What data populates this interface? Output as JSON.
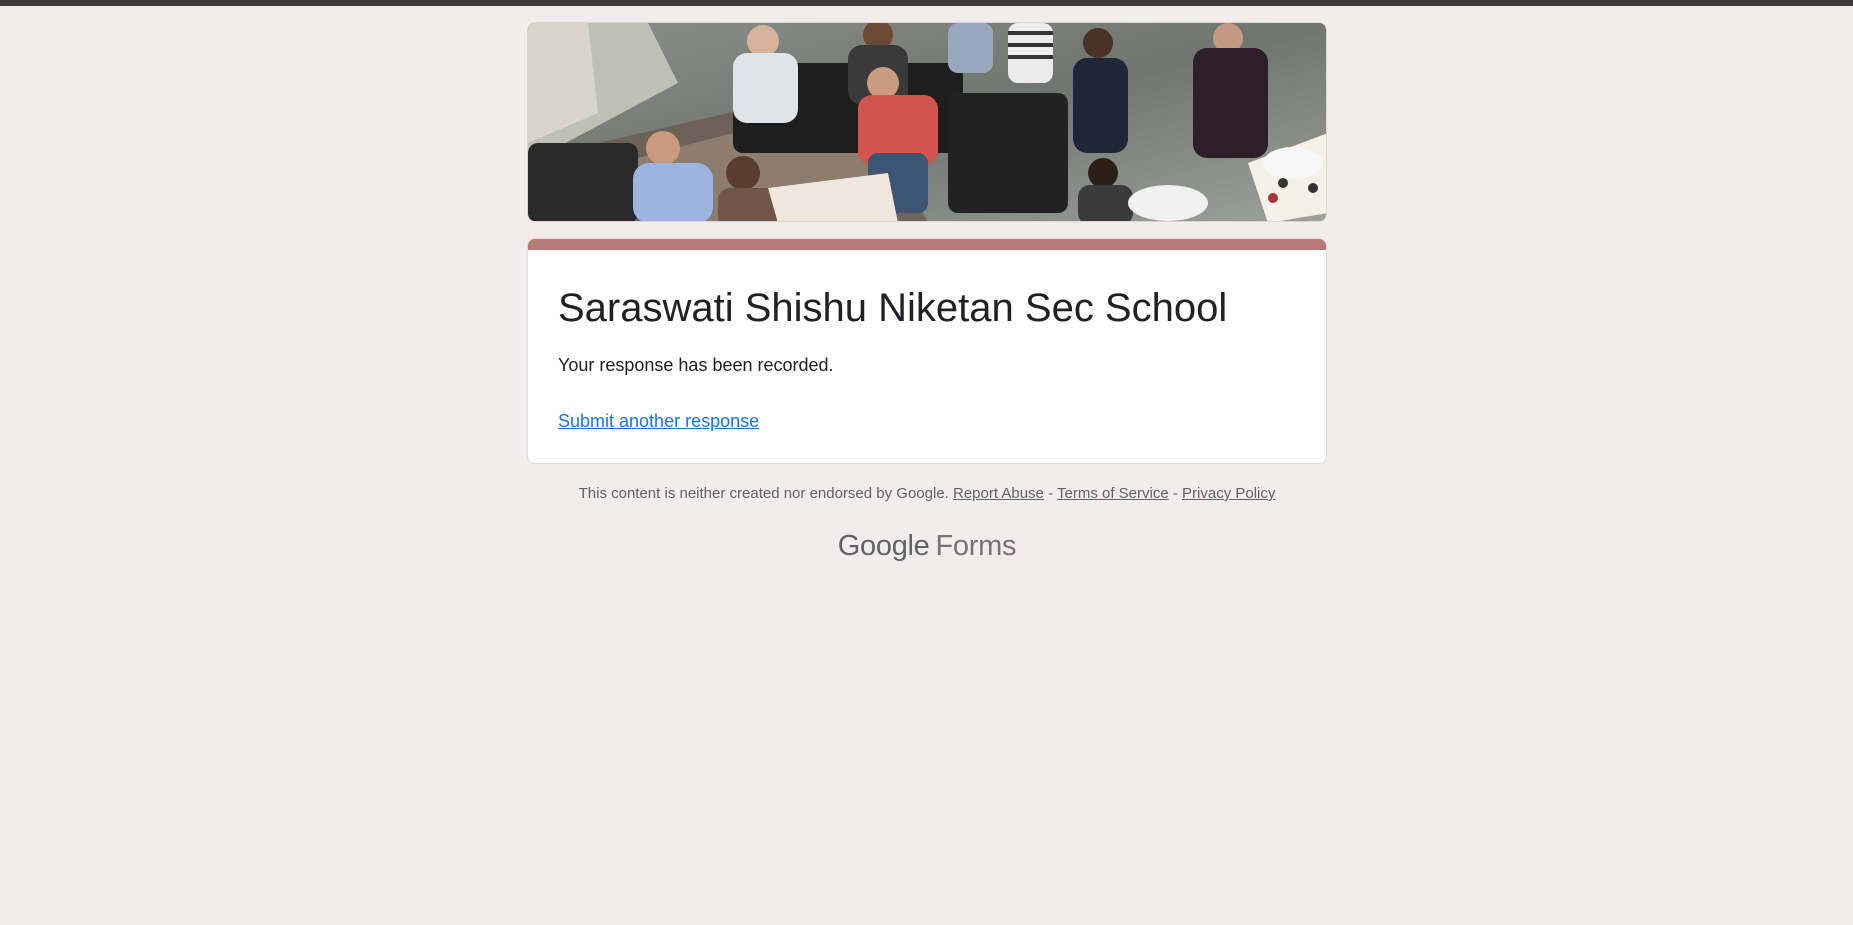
{
  "form": {
    "title": "Saraswati Shishu Niketan Sec School",
    "confirmation_message": "Your response has been recorded.",
    "submit_another_label": "Submit another response"
  },
  "footer": {
    "disclaimer": "This content is neither created nor endorsed by Google.",
    "report_abuse": "Report Abuse",
    "separator": "-",
    "terms": "Terms of Service",
    "privacy": "Privacy Policy"
  },
  "branding": {
    "google": "Google",
    "forms": "Forms"
  },
  "colors": {
    "page_background": "#f3ecec",
    "accent": "#b77a76",
    "link": "#1a73e8",
    "muted_text": "#5f6368"
  },
  "icons": {
    "banner": "header-photo"
  }
}
